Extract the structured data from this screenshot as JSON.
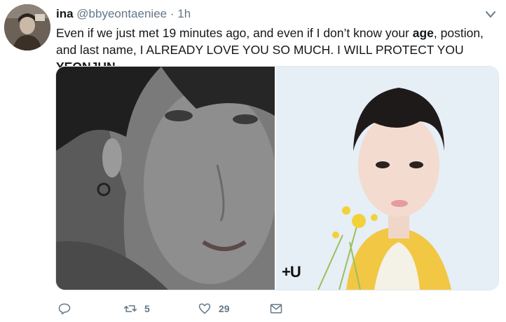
{
  "tweet": {
    "author_name": "ina",
    "author_handle": "@bbyeontaeniee",
    "separator": "·",
    "time": "1h",
    "text_part1": "Even if we just met 19 minutes ago, and even if I don’t know your ",
    "text_bold1": "age",
    "text_part2": ", postion, and last name, I ALREADY LOVE YOU SO MUCH. I WILL PROTECT YOU ",
    "text_bold2": "YEONJUN",
    "media_logo": "+U"
  },
  "actions": {
    "reply_icon": "reply-icon",
    "retweet_icon": "retweet-icon",
    "retweet_count": "5",
    "like_icon": "heart-icon",
    "like_count": "29",
    "dm_icon": "mail-icon"
  },
  "colors": {
    "text": "#14171a",
    "secondary": "#657786",
    "border": "#e1e8ed"
  }
}
